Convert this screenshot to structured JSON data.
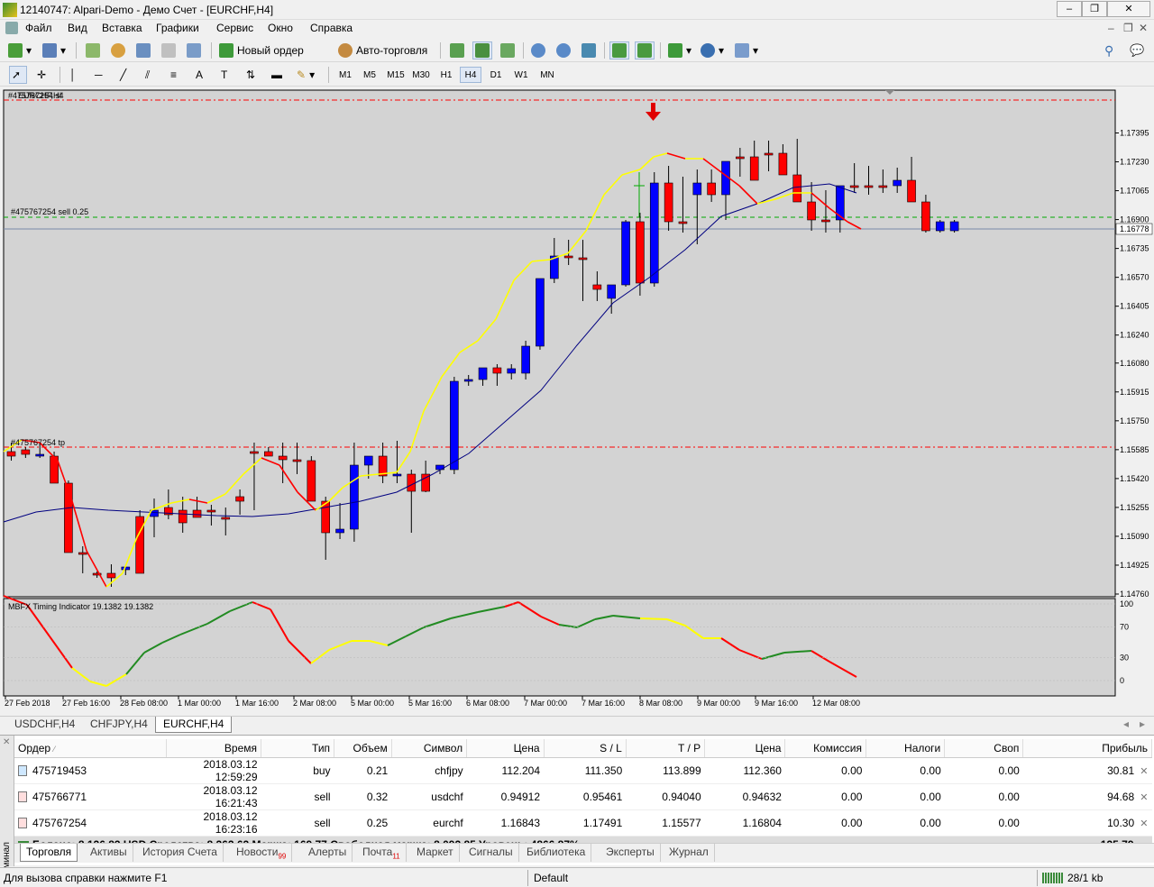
{
  "window": {
    "title": "12140747: Alpari-Demo - Демо Счет - [EURCHF,H4]"
  },
  "menu": [
    "Файл",
    "Вид",
    "Вставка",
    "Графики",
    "Сервис",
    "Окно",
    "Справка"
  ],
  "toolbar": {
    "new_order": "Новый ордер",
    "autotrading": "Авто-торговля"
  },
  "timeframes": [
    "M1",
    "M5",
    "M15",
    "M30",
    "H1",
    "H4",
    "D1",
    "W1",
    "MN"
  ],
  "active_timeframe": "H4",
  "chart": {
    "symbol_label": "#475767254 sl",
    "symbol_label_overlay": "EURCHF,H4",
    "sell_line_label": "#475767254 sell 0.25",
    "tp_line_label": "#475767254 tp",
    "current_price": "1.16778",
    "price_ticks": [
      "1.17395",
      "1.17230",
      "1.17065",
      "1.16900",
      "1.16735",
      "1.16570",
      "1.16405",
      "1.16240",
      "1.16080",
      "1.15915",
      "1.15750",
      "1.15585",
      "1.15420",
      "1.15255",
      "1.15090",
      "1.14925",
      "1.14760"
    ],
    "indicator_label": "MBFX Timing Indicator 19.1382 19.1382",
    "indicator_ticks": [
      "100",
      "70",
      "30",
      "0"
    ],
    "time_ticks": [
      "27 Feb 2018",
      "27 Feb 16:00",
      "28 Feb 08:00",
      "1 Mar 00:00",
      "1 Mar 16:00",
      "2 Mar 08:00",
      "5 Mar 00:00",
      "5 Mar 16:00",
      "6 Mar 08:00",
      "7 Mar 00:00",
      "7 Mar 16:00",
      "8 Mar 08:00",
      "9 Mar 00:00",
      "9 Mar 16:00",
      "12 Mar 08:00"
    ],
    "colors": {
      "bull": "#0000ff",
      "bear": "#ff0000",
      "ma_fast": "#ffff00",
      "ma_slow": "#000080",
      "bg": "#d3d3d3"
    }
  },
  "chart_tabs": [
    "USDCHF,H4",
    "CHFJPY,H4",
    "EURCHF,H4"
  ],
  "active_chart_tab": "EURCHF,H4",
  "orders": {
    "headers": [
      "Ордер",
      "Время",
      "Тип",
      "Объем",
      "Символ",
      "Цена",
      "S / L",
      "T / P",
      "Цена",
      "Комиссия",
      "Налоги",
      "Своп",
      "Прибыль"
    ],
    "rows": [
      [
        "475719453",
        "2018.03.12 12:59:29",
        "buy",
        "0.21",
        "chfjpy",
        "112.204",
        "111.350",
        "113.899",
        "112.360",
        "0.00",
        "0.00",
        "0.00",
        "30.81"
      ],
      [
        "475766771",
        "2018.03.12 16:21:43",
        "sell",
        "0.32",
        "usdchf",
        "0.94912",
        "0.95461",
        "0.94040",
        "0.94632",
        "0.00",
        "0.00",
        "0.00",
        "94.68"
      ],
      [
        "475767254",
        "2018.03.12 16:23:16",
        "sell",
        "0.25",
        "eurchf",
        "1.16843",
        "1.17491",
        "1.15577",
        "1.16804",
        "0.00",
        "0.00",
        "0.00",
        "10.30"
      ]
    ],
    "balance_line": "Баланс: 8 126.83 USD  Средства: 8 262.62  Маржа: 169.77  Свободная маржа: 8 092.85  Уровень: 4866.87%",
    "total_profit": "135.79"
  },
  "terminal": {
    "side_label": "Терминал",
    "tabs": [
      {
        "label": "Торговля"
      },
      {
        "label": "Активы"
      },
      {
        "label": "История Счета"
      },
      {
        "label": "Новости",
        "badge": "99"
      },
      {
        "label": "Алерты"
      },
      {
        "label": "Почта",
        "badge": "11"
      },
      {
        "label": "Маркет"
      },
      {
        "label": "Сигналы"
      },
      {
        "label": "Библиотека"
      },
      {
        "label": "Эксперты"
      },
      {
        "label": "Журнал"
      }
    ]
  },
  "status": {
    "help": "Для вызова справки нажмите F1",
    "profile": "Default",
    "traffic": "28/1 kb"
  }
}
